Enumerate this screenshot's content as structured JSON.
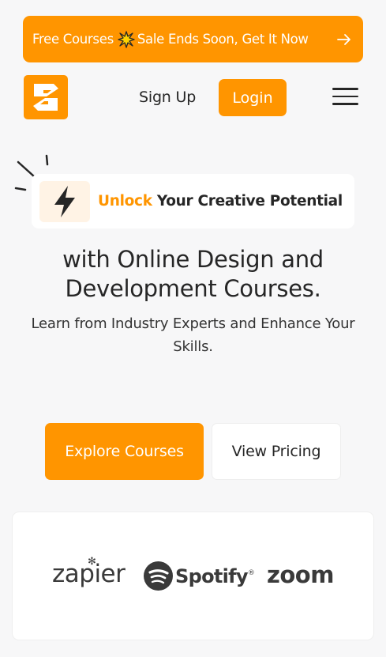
{
  "banner": {
    "text_before": "Free Courses",
    "text_after": "Sale Ends Soon, Get It Now",
    "burst_icon": "sparkle-burst-icon",
    "arrow_icon": "arrow-right-icon"
  },
  "nav": {
    "signup_label": "Sign Up",
    "login_label": "Login",
    "menu_icon": "hamburger-menu-icon",
    "logo_icon": "brand-logo-icon"
  },
  "hero": {
    "pill_accent": "Unlock",
    "pill_rest": " Your Creative Potential",
    "headline_line1": "with Online Design and",
    "headline_line2": "Development Courses.",
    "subtext": "Learn from Industry Experts and Enhance Your Skills.",
    "bolt_icon": "lightning-bolt-icon"
  },
  "cta": {
    "primary_label": "Explore Courses",
    "secondary_label": "View Pricing"
  },
  "partners": {
    "zapier": "zapier",
    "spotify": "Spotify",
    "spotify_mark": "®",
    "zoom": "zoom"
  },
  "colors": {
    "accent": "#ff9500",
    "background": "#f7f7f8",
    "text": "#262626"
  }
}
